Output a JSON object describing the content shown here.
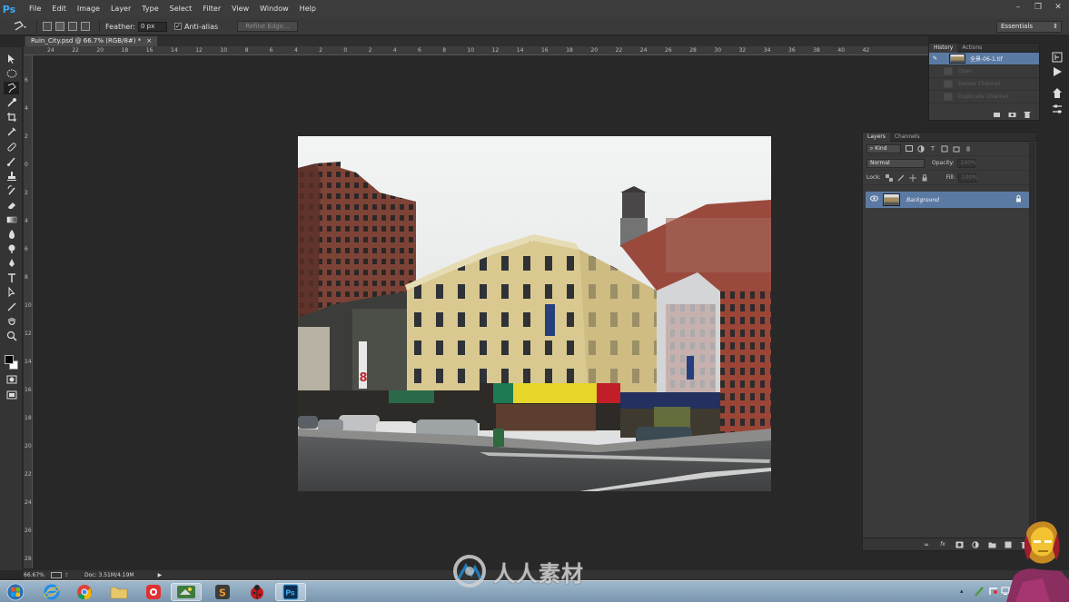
{
  "app": {
    "logo": "Ps",
    "menus": [
      "File",
      "Edit",
      "Image",
      "Layer",
      "Type",
      "Select",
      "Filter",
      "View",
      "Window",
      "Help"
    ]
  },
  "options_bar": {
    "feather_label": "Feather:",
    "feather_value": "0 px",
    "antialias_label": "Anti-alias",
    "antialias_checked": true,
    "refine_edge_label": "Refine Edge...",
    "workspace": "Essentials"
  },
  "document": {
    "tab_title": "Ruin_City.psd @ 66.7% (RGB/8#) *",
    "tab_close": "×"
  },
  "ruler": {
    "top_labels": [
      "24",
      "22",
      "20",
      "18",
      "16",
      "14",
      "12",
      "10",
      "8",
      "6",
      "4",
      "2",
      "0",
      "2",
      "4",
      "6",
      "8",
      "10",
      "12",
      "14",
      "16",
      "18",
      "20",
      "22",
      "24",
      "26",
      "28",
      "30",
      "32",
      "34",
      "36",
      "38",
      "40",
      "42"
    ],
    "left_labels": [
      "6",
      "4",
      "2",
      "0",
      "2",
      "4",
      "6",
      "8",
      "10",
      "12",
      "14",
      "16",
      "18",
      "20",
      "22",
      "24",
      "26",
      "28"
    ]
  },
  "history_panel": {
    "tabs": [
      "History",
      "Actions"
    ],
    "active_tab": "History",
    "snapshot_name": "全景-06-1.tif",
    "states": [
      "Open",
      "Delete Channel",
      "Duplicate Channel"
    ]
  },
  "layers_panel": {
    "tabs": [
      "Layers",
      "Channels"
    ],
    "active_tab": "Layers",
    "filter_kind": "Kind",
    "blend_mode": "Normal",
    "opacity_label": "Opacity:",
    "opacity_value": "100%",
    "lock_label": "Lock:",
    "fill_label": "Fill:",
    "fill_value": "100%",
    "layers": [
      {
        "name": "Background",
        "visible": true,
        "locked": true,
        "selected": true
      }
    ]
  },
  "status_bar": {
    "zoom": "66.67%",
    "doc_info": "Doc: 3.51M/4.19M"
  },
  "watermark": {
    "text": "人人素材"
  },
  "colors": {
    "menubar": "#3c3c3c",
    "canvas_bg": "#282828",
    "selection_blue": "#5b7aa3",
    "ps_blue": "#3fa8f4"
  }
}
